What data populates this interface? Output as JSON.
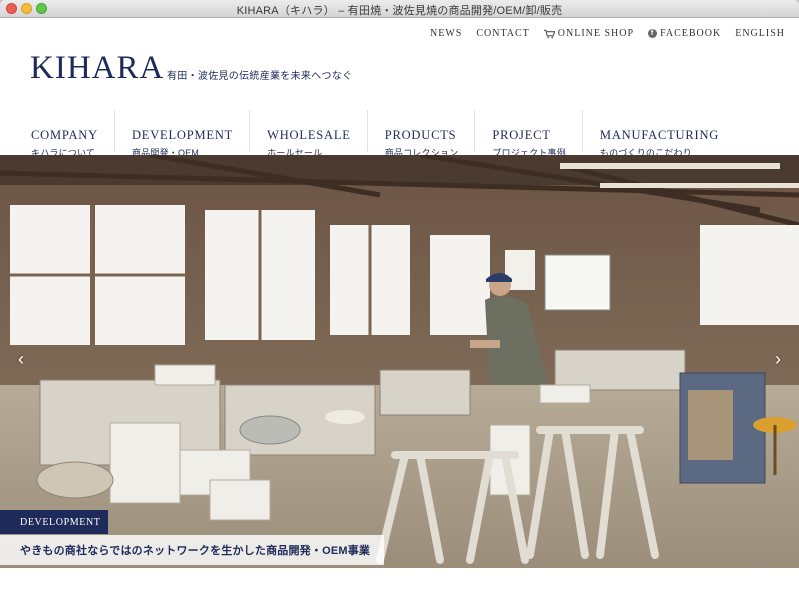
{
  "window": {
    "title": "KIHARA（キハラ） – 有田焼・波佐見焼の商品開発/OEM/卸/販売"
  },
  "topnav": {
    "items": [
      {
        "label": "NEWS",
        "icon": ""
      },
      {
        "label": "CONTACT",
        "icon": ""
      },
      {
        "label": "ONLINE SHOP",
        "icon": "cart-icon"
      },
      {
        "label": "FACEBOOK",
        "icon": "facebook-icon"
      },
      {
        "label": "ENGLISH",
        "icon": ""
      }
    ]
  },
  "header": {
    "logo": "KIHARA",
    "tagline": "有田・波佐見の伝統産業を未来へつなぐ"
  },
  "mainnav": {
    "items": [
      {
        "en": "COMPANY",
        "jp": "キハラについて"
      },
      {
        "en": "DEVELOPMENT",
        "jp": "商品開発・OEM"
      },
      {
        "en": "WHOLESALE",
        "jp": "ホールセール"
      },
      {
        "en": "PRODUCTS",
        "jp": "商品コレクション"
      },
      {
        "en": "PROJECT",
        "jp": "プロジェクト事例"
      },
      {
        "en": "MANUFACTURING",
        "jp": "ものづくりのこだわり"
      }
    ]
  },
  "hero": {
    "tag": "DEVELOPMENT",
    "caption": "やきもの商社ならではのネットワークを生かした商品開発・OEM事業"
  },
  "colors": {
    "brand_navy": "#1d2a5a"
  }
}
